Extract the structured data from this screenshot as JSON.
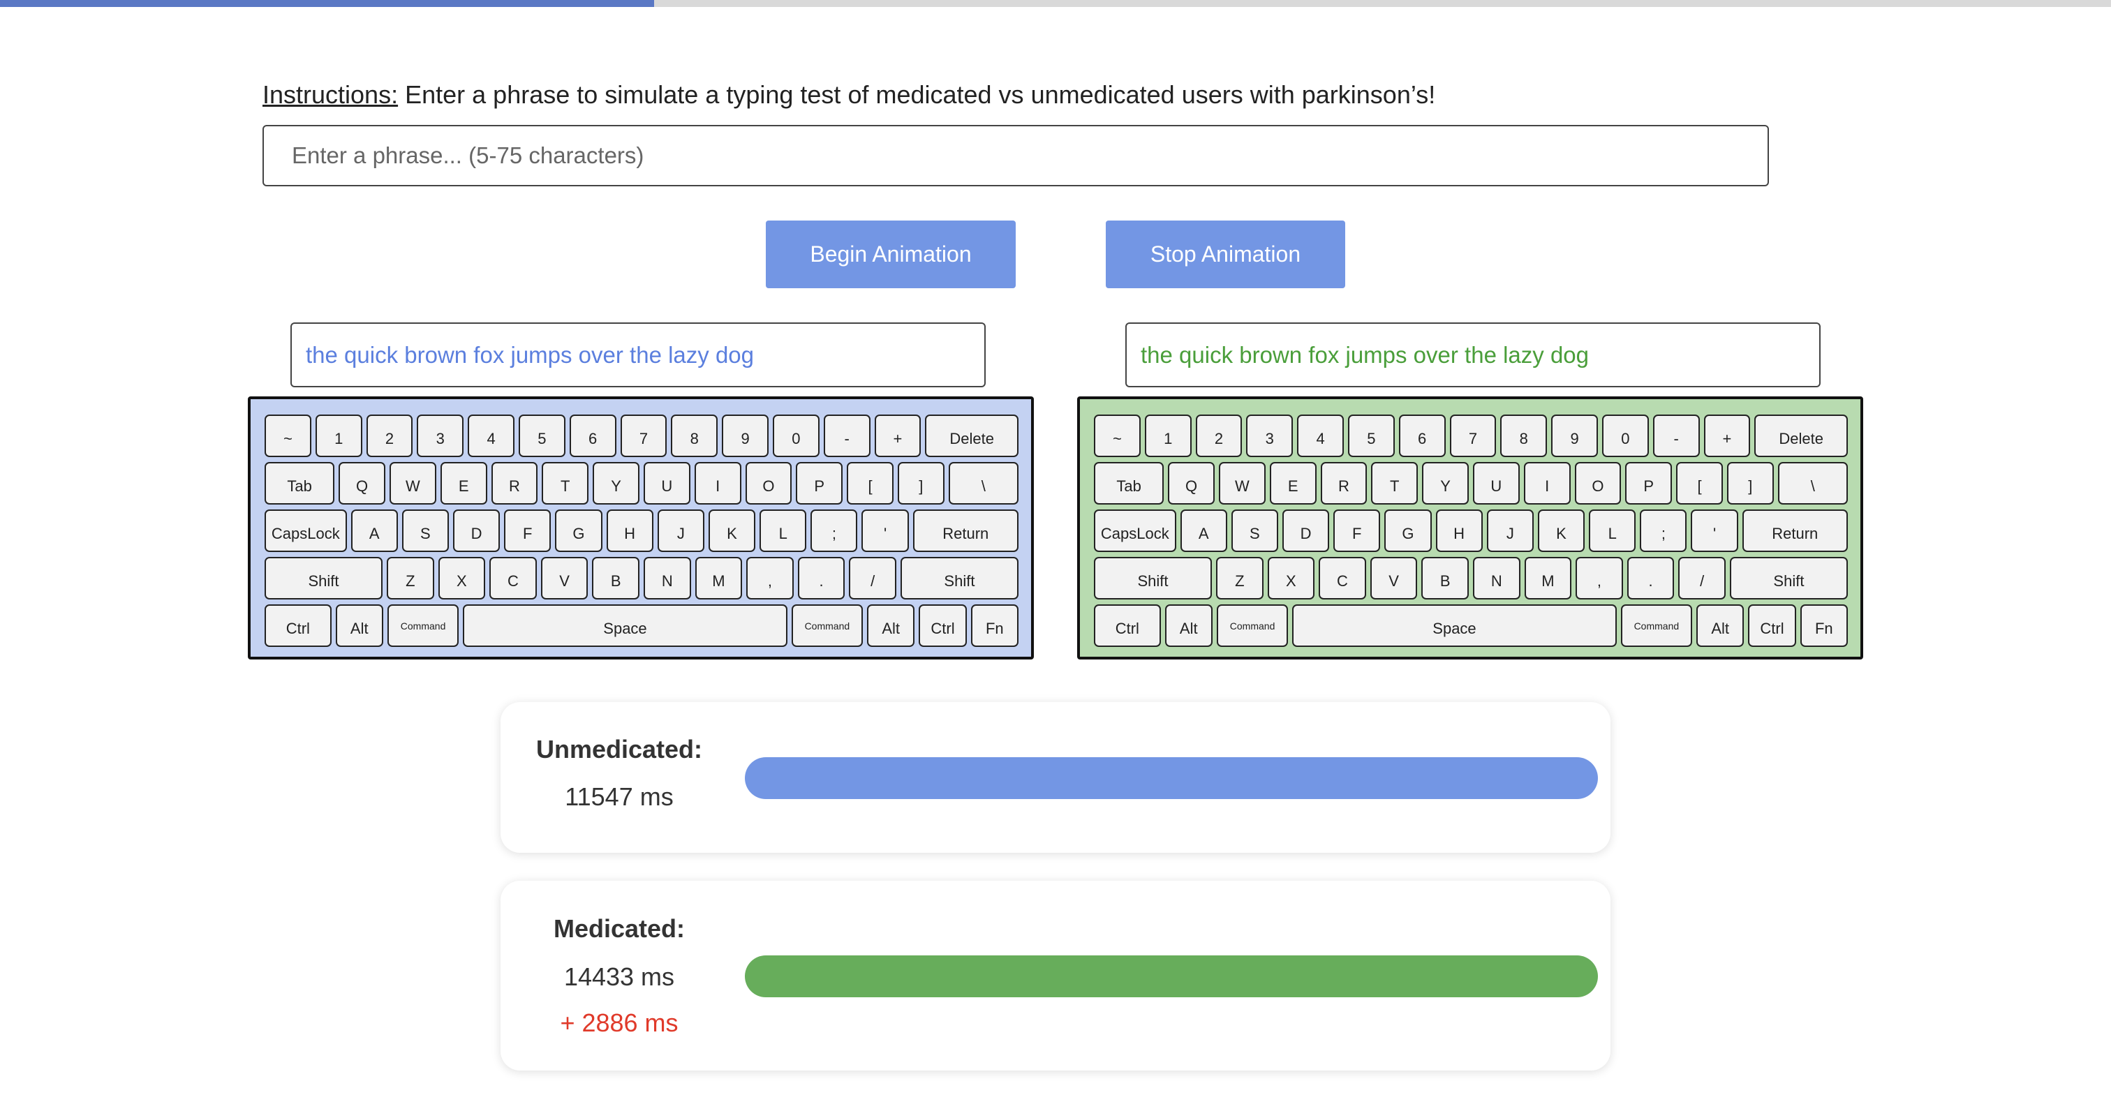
{
  "progress": {
    "fraction": 0.31,
    "color": "#5a78c4"
  },
  "instructions": {
    "label": "Instructions:",
    "text": " Enter a phrase to simulate a typing test of medicated vs unmedicated users with parkinson’s!"
  },
  "phrase_input": {
    "placeholder": "Enter a phrase... (5-75 characters)",
    "value": ""
  },
  "buttons": {
    "begin": "Begin Animation",
    "stop": "Stop Animation"
  },
  "outputs": {
    "left": {
      "text": "the quick brown fox jumps over the lazy dog",
      "color": "#5b7fde"
    },
    "right": {
      "text": "the quick brown fox jumps over the lazy dog",
      "color": "#4a9e3a"
    }
  },
  "keyboard": {
    "left_bg": "#c4d2f2",
    "right_bg": "#b8dbb0",
    "rows": [
      [
        {
          "label": "~"
        },
        {
          "label": "1"
        },
        {
          "label": "2"
        },
        {
          "label": "3"
        },
        {
          "label": "4"
        },
        {
          "label": "5"
        },
        {
          "label": "6"
        },
        {
          "label": "7"
        },
        {
          "label": "8"
        },
        {
          "label": "9"
        },
        {
          "label": "0"
        },
        {
          "label": "-"
        },
        {
          "label": "+"
        },
        {
          "label": "Delete",
          "w": 2
        }
      ],
      [
        {
          "label": "Tab",
          "w": 1.5
        },
        {
          "label": "Q"
        },
        {
          "label": "W"
        },
        {
          "label": "E"
        },
        {
          "label": "R"
        },
        {
          "label": "T"
        },
        {
          "label": "Y"
        },
        {
          "label": "U"
        },
        {
          "label": "I"
        },
        {
          "label": "O"
        },
        {
          "label": "P"
        },
        {
          "label": "["
        },
        {
          "label": "]"
        },
        {
          "label": "\\",
          "w": 1.5
        }
      ],
      [
        {
          "label": "CapsLock",
          "w": 1.75
        },
        {
          "label": "A"
        },
        {
          "label": "S"
        },
        {
          "label": "D"
        },
        {
          "label": "F"
        },
        {
          "label": "G"
        },
        {
          "label": "H"
        },
        {
          "label": "J"
        },
        {
          "label": "K"
        },
        {
          "label": "L"
        },
        {
          "label": ";"
        },
        {
          "label": "'"
        },
        {
          "label": "Return",
          "w": 2.25
        }
      ],
      [
        {
          "label": "Shift",
          "w": 2.5
        },
        {
          "label": "Z"
        },
        {
          "label": "X"
        },
        {
          "label": "C"
        },
        {
          "label": "V"
        },
        {
          "label": "B"
        },
        {
          "label": "N"
        },
        {
          "label": "M"
        },
        {
          "label": ","
        },
        {
          "label": "."
        },
        {
          "label": "/"
        },
        {
          "label": "Shift",
          "w": 2.5
        }
      ],
      [
        {
          "label": "Ctrl",
          "w": 1.4
        },
        {
          "label": "Alt"
        },
        {
          "label": "Command",
          "w": 1.5,
          "small": true
        },
        {
          "label": "Space",
          "w": 6.8
        },
        {
          "label": "Command",
          "w": 1.5,
          "small": true
        },
        {
          "label": "Alt"
        },
        {
          "label": "Ctrl"
        },
        {
          "label": "Fn"
        }
      ]
    ]
  },
  "results": {
    "unmedicated": {
      "title": "Unmedicated:",
      "time": "11547 ms",
      "bar_fraction": 1.0,
      "color": "#7396e4"
    },
    "medicated": {
      "title": "Medicated:",
      "time": "14433 ms",
      "delta": "+ 2886 ms",
      "bar_fraction": 1.0,
      "color": "#67ad5b"
    }
  }
}
